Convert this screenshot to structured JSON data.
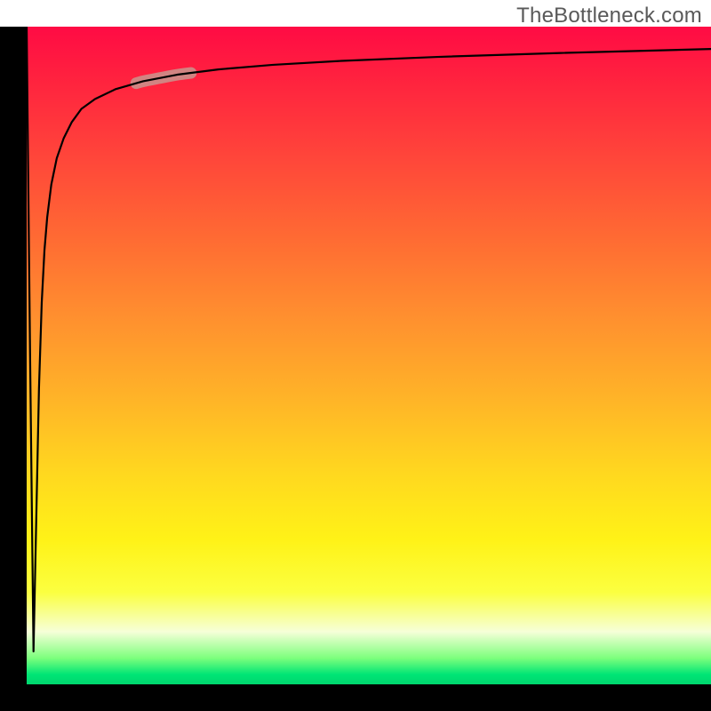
{
  "watermark": "TheBottleneck.com",
  "chart_data": {
    "type": "line",
    "title": "",
    "xlabel": "",
    "ylabel": "",
    "xlim": [
      0,
      100
    ],
    "ylim": [
      0,
      100
    ],
    "background": "vertical-gradient red→orange→yellow→green",
    "series": [
      {
        "name": "curve",
        "x": [
          0,
          0.5,
          1.0,
          1.4,
          1.8,
          2.2,
          2.6,
          3.0,
          3.6,
          4.4,
          5.4,
          6.6,
          8.0,
          10.0,
          13.0,
          17.0,
          22.0,
          28.0,
          36.0,
          46.0,
          60.0,
          78.0,
          100.0
        ],
        "values": [
          100,
          50,
          5,
          25,
          45,
          58,
          66,
          71,
          76,
          80,
          83,
          85.5,
          87.5,
          89,
          90.5,
          91.7,
          92.7,
          93.5,
          94.2,
          94.8,
          95.4,
          96.0,
          96.6
        ]
      }
    ],
    "highlight": {
      "x_range": [
        16,
        24
      ],
      "note": "short pale segment overlaid on rising part of curve"
    }
  }
}
